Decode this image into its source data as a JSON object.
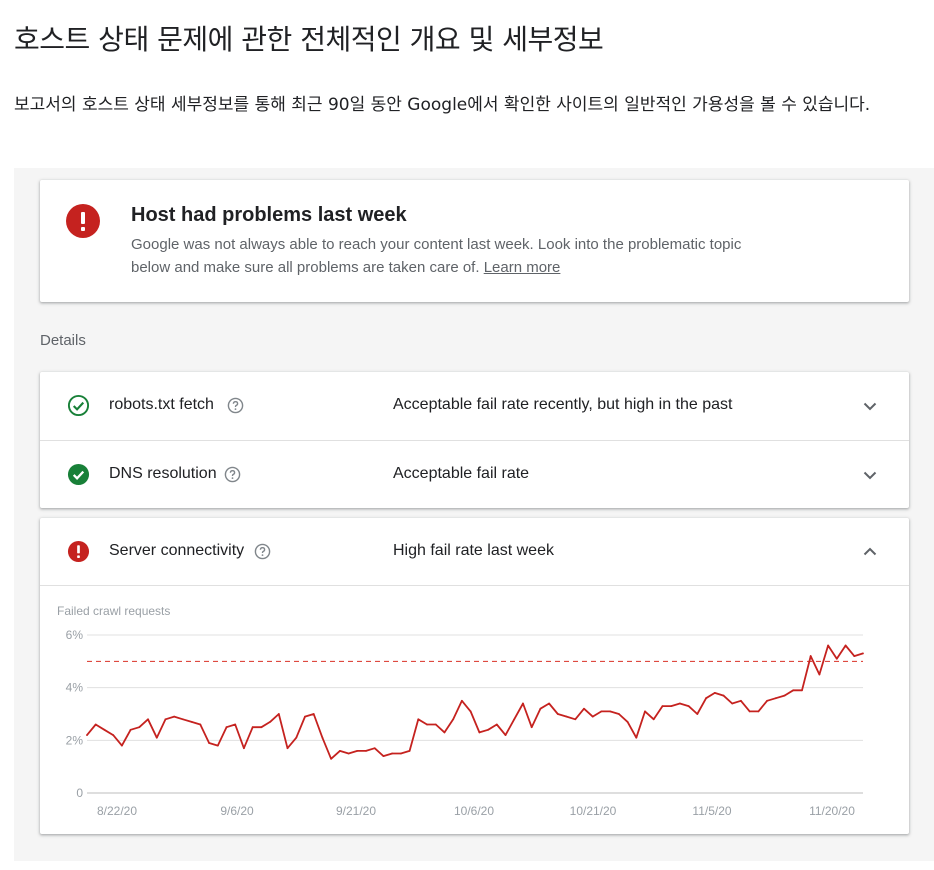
{
  "page": {
    "heading": "호스트 상태 문제에 관한 전체적인 개요 및 세부정보",
    "intro": "보고서의 호스트 상태 세부정보를 통해 최근 90일 동안 Google에서 확인한 사이트의 일반적인 가용성을 볼 수 있습니다."
  },
  "summary": {
    "icon": "error-icon",
    "title": "Host had problems last week",
    "description": "Google was not always able to reach your content last week. Look into the problematic topic below and make sure all problems are taken care of.",
    "learn_more": "Learn more"
  },
  "details": {
    "label": "Details",
    "rows": [
      {
        "name": "robots.txt fetch",
        "status": "ok-outline",
        "state": "Acceptable fail rate recently, but high in the past",
        "expanded": false
      },
      {
        "name": "DNS resolution",
        "status": "ok-filled",
        "state": "Acceptable fail rate",
        "expanded": false
      },
      {
        "name": "Server connectivity",
        "status": "error",
        "state": "High fail rate last week",
        "expanded": true
      }
    ]
  },
  "colors": {
    "error": "#c5221f",
    "ok": "#188038",
    "line": "#c5221f",
    "threshold": "#d93025",
    "grid": "#e0e0e0"
  },
  "chart_data": {
    "type": "line",
    "title": "Failed crawl requests",
    "ylim": [
      0,
      6
    ],
    "yticks": [
      "0",
      "2%",
      "4%",
      "6%"
    ],
    "xticks": [
      "8/22/20",
      "9/6/20",
      "9/21/20",
      "10/6/20",
      "10/21/20",
      "11/5/20",
      "11/20/20"
    ],
    "threshold": 5,
    "series": [
      {
        "values": [
          2.2,
          2.6,
          2.4,
          2.2,
          1.8,
          2.4,
          2.5,
          2.8,
          2.1,
          2.8,
          2.9,
          2.8,
          2.7,
          2.6,
          1.9,
          1.8,
          2.5,
          2.6,
          1.7,
          2.5,
          2.5,
          2.7,
          3.0,
          1.7,
          2.1,
          2.9,
          3.0,
          2.1,
          1.3,
          1.6,
          1.5,
          1.6,
          1.6,
          1.7,
          1.4,
          1.5,
          1.5,
          1.6,
          2.8,
          2.6,
          2.6,
          2.3,
          2.8,
          3.5,
          3.1,
          2.3,
          2.4,
          2.6,
          2.2,
          2.8,
          3.4,
          2.5,
          3.2,
          3.4,
          3.0,
          2.9,
          2.8,
          3.2,
          2.9,
          3.1,
          3.1,
          3.0,
          2.7,
          2.1,
          3.1,
          2.8,
          3.3,
          3.3,
          3.4,
          3.3,
          3.0,
          3.6,
          3.8,
          3.7,
          3.4,
          3.5,
          3.1,
          3.1,
          3.5,
          3.6,
          3.7,
          3.9,
          3.9,
          5.2,
          4.5,
          5.6,
          5.1,
          5.6,
          5.2,
          5.3
        ]
      }
    ]
  }
}
